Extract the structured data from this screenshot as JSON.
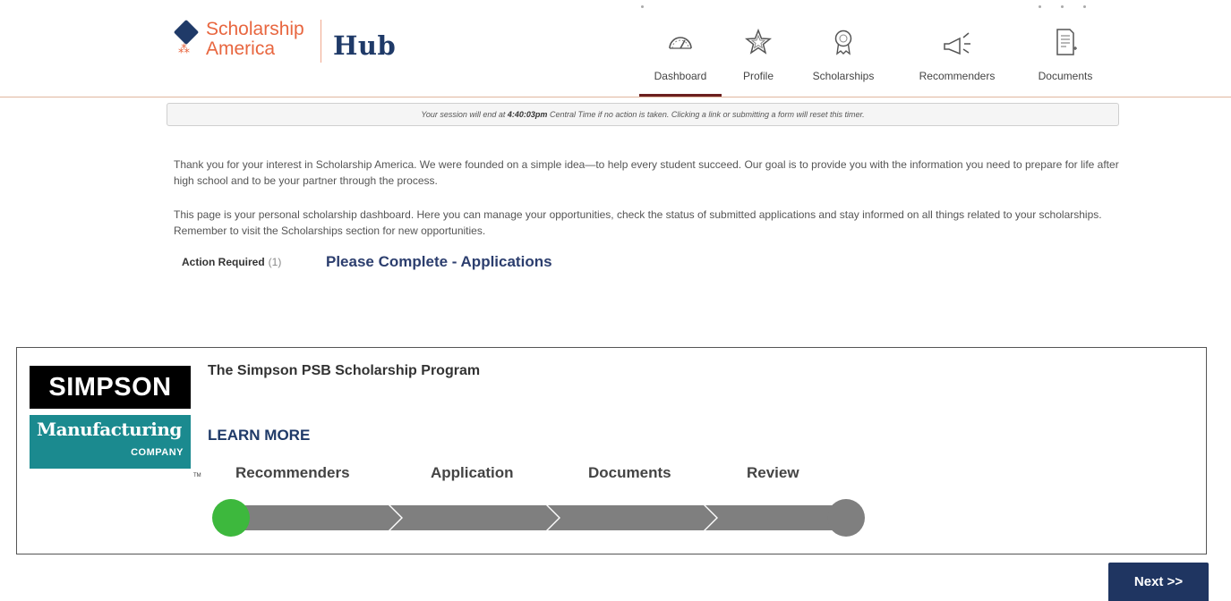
{
  "brand": {
    "name_line1": "Scholarship",
    "name_line2": "America",
    "product": "Hub",
    "accent": "#e8663f",
    "navy": "#1f3a68"
  },
  "nav": {
    "items": [
      {
        "label": "Dashboard",
        "icon": "speedometer-icon",
        "active": true
      },
      {
        "label": "Profile",
        "icon": "star-icon",
        "active": false
      },
      {
        "label": "Scholarships",
        "icon": "award-ribbon-icon",
        "active": false
      },
      {
        "label": "Recommenders",
        "icon": "megaphone-icon",
        "active": false
      },
      {
        "label": "Documents",
        "icon": "document-icon",
        "active": false
      }
    ]
  },
  "session": {
    "prefix": "Your session will end at ",
    "time": "4:40:03pm",
    "suffix": " Central Time if no action is taken. Clicking a link or submitting a form will reset this timer."
  },
  "intro": {
    "paragraph1": "Thank you for your interest in Scholarship America. We were founded on a simple idea—to help every student succeed. Our goal is to provide you with the information you need to prepare for life after high school and to be your partner through the process.",
    "paragraph2": "This page is your personal scholarship dashboard. Here you can manage your opportunities, check the status of submitted applications and stay informed on all things related to your scholarships. Remember to visit the Scholarships section for new opportunities."
  },
  "action": {
    "label": "Action Required",
    "count": "(1)",
    "link": "Please Complete - Applications"
  },
  "card": {
    "sponsor_line1": "SIMPSON",
    "sponsor_line2": "Manufacturing",
    "sponsor_line3": "COMPANY",
    "sponsor_tm": "TM",
    "title": "The Simpson PSB Scholarship Program",
    "learn_more": "LEARN MORE",
    "steps": [
      "Recommenders",
      "Application",
      "Documents",
      "Review"
    ],
    "completed_steps": 0,
    "progress_done_color": "#3db83d",
    "progress_todo_color": "#7f7f7f"
  },
  "pager": {
    "next_label": "Next >>"
  }
}
